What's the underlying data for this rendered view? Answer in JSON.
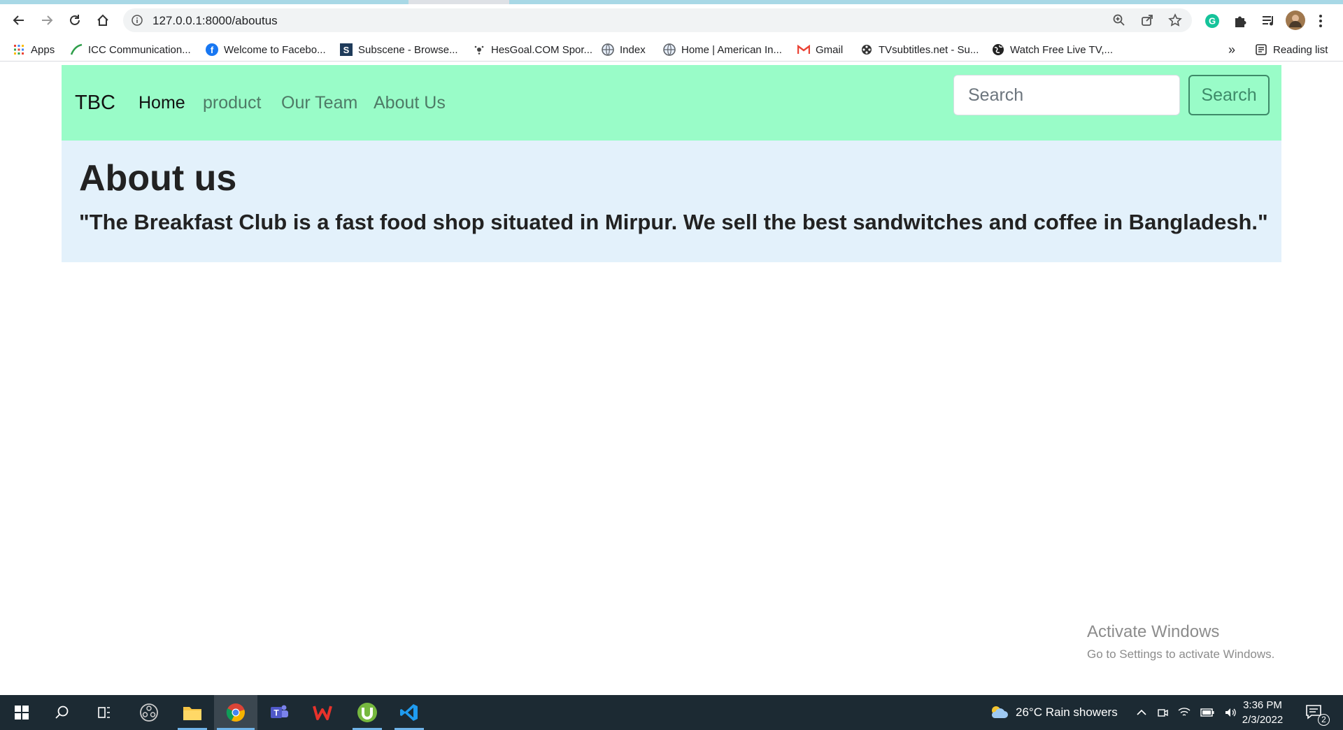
{
  "browser": {
    "url": "127.0.0.1:8000/aboutus",
    "bookmarks": [
      {
        "label": "Apps",
        "icon": "apps-grid-icon"
      },
      {
        "label": "ICC Communication...",
        "icon": "icc-icon"
      },
      {
        "label": "Welcome to Facebo...",
        "icon": "facebook-icon"
      },
      {
        "label": "Subscene - Browse...",
        "icon": "subscene-icon"
      },
      {
        "label": "HesGoal.COM Spor...",
        "icon": "ball-icon"
      },
      {
        "label": "Index",
        "icon": "globe-icon"
      },
      {
        "label": "Home | American In...",
        "icon": "globe-icon"
      },
      {
        "label": "Gmail",
        "icon": "gmail-icon"
      },
      {
        "label": "TVsubtitles.net - Su...",
        "icon": "film-icon"
      },
      {
        "label": "Watch Free Live TV,...",
        "icon": "world-icon"
      }
    ],
    "more_label": "»",
    "reading_list_label": "Reading list"
  },
  "page": {
    "brand": "TBC",
    "nav": [
      {
        "label": "Home",
        "active": true
      },
      {
        "label": "product",
        "active": false
      },
      {
        "label": "Our Team",
        "active": false
      },
      {
        "label": "About Us",
        "active": false
      }
    ],
    "search_placeholder": "Search",
    "search_button": "Search",
    "heading": "About us",
    "description": "\"The Breakfast Club is a fast food shop situated in Mirpur. We sell the best sandwitches and coffee in Bangladesh.\""
  },
  "watermark": {
    "title": "Activate Windows",
    "subtitle": "Go to Settings to activate Windows."
  },
  "taskbar": {
    "weather": "26°C  Rain showers",
    "time": "3:36 PM",
    "date": "2/3/2022",
    "notifications": "2"
  },
  "colors": {
    "navbar": "#99fcc8",
    "jumbotron": "#e3f1fb",
    "search_button": "#3e8a69"
  }
}
